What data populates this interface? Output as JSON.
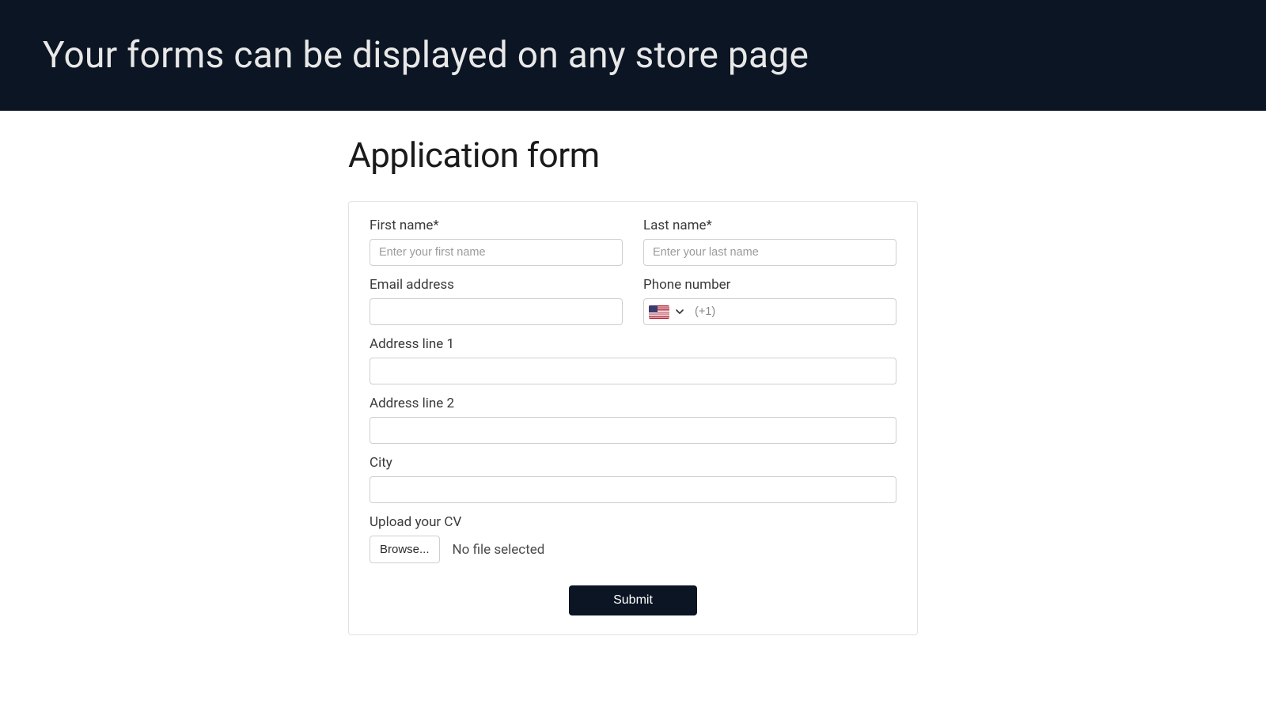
{
  "header": {
    "title": "Your forms can be displayed on any store page"
  },
  "page": {
    "title": "Application form"
  },
  "form": {
    "first_name": {
      "label": "First name*",
      "placeholder": "Enter your first name",
      "value": ""
    },
    "last_name": {
      "label": "Last name*",
      "placeholder": "Enter your last name",
      "value": ""
    },
    "email": {
      "label": "Email address",
      "value": ""
    },
    "phone": {
      "label": "Phone number",
      "country_code_placeholder": "(+1)",
      "flag_icon": "us-flag-icon",
      "value": ""
    },
    "address1": {
      "label": "Address line 1",
      "value": ""
    },
    "address2": {
      "label": "Address line 2",
      "value": ""
    },
    "city": {
      "label": "City",
      "value": ""
    },
    "cv": {
      "label": "Upload your CV",
      "browse_label": "Browse...",
      "status": "No file selected"
    },
    "submit_label": "Submit"
  },
  "colors": {
    "header_bg": "#0b1523",
    "submit_bg": "#0b1523",
    "border": "#cfcfcf"
  }
}
